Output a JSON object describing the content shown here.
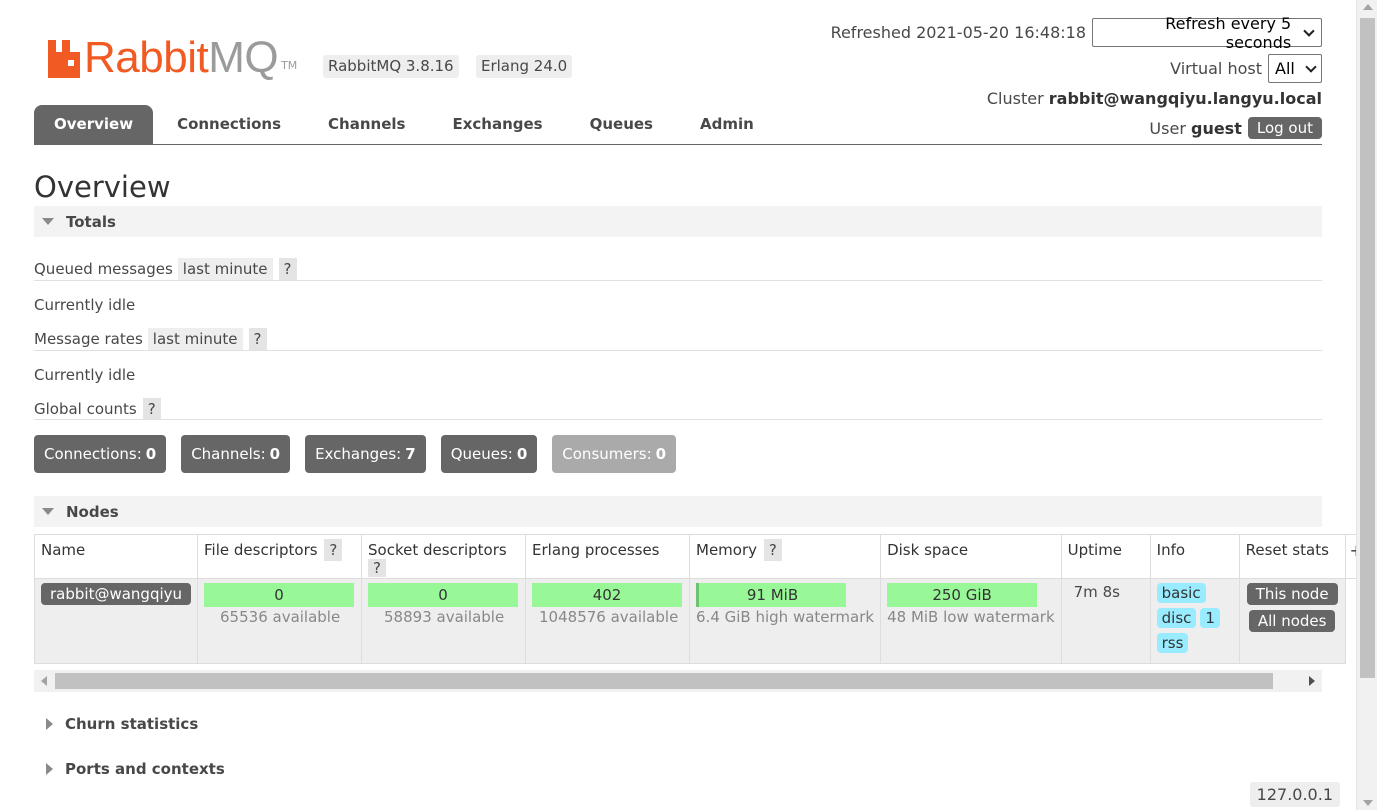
{
  "brand": {
    "logo_rabbit": "Rabbit",
    "logo_mq": "MQ",
    "logo_tm": "TM"
  },
  "versions": {
    "rabbitmq": "RabbitMQ 3.8.16",
    "erlang": "Erlang 24.0"
  },
  "header": {
    "refreshed_label": "Refreshed 2021-05-20 16:48:18",
    "refresh_select": "Refresh every 5 seconds",
    "vhost_label": "Virtual host",
    "vhost_select": "All",
    "cluster_label": "Cluster",
    "cluster_name": "rabbit@wangqiyu.langyu.local",
    "user_label": "User",
    "user_name": "guest",
    "logout": "Log out"
  },
  "tabs": [
    {
      "label": "Overview",
      "active": true
    },
    {
      "label": "Connections"
    },
    {
      "label": "Channels"
    },
    {
      "label": "Exchanges"
    },
    {
      "label": "Queues"
    },
    {
      "label": "Admin"
    }
  ],
  "page_title": "Overview",
  "totals": {
    "heading": "Totals",
    "queued_label": "Queued messages",
    "queued_range": "last minute",
    "help": "?",
    "queued_idle": "Currently idle",
    "rates_label": "Message rates",
    "rates_range": "last minute",
    "rates_idle": "Currently idle",
    "global_label": "Global counts"
  },
  "counts": [
    {
      "label": "Connections:",
      "value": "0"
    },
    {
      "label": "Channels:",
      "value": "0"
    },
    {
      "label": "Exchanges:",
      "value": "7"
    },
    {
      "label": "Queues:",
      "value": "0"
    },
    {
      "label": "Consumers:",
      "value": "0"
    }
  ],
  "nodes": {
    "heading": "Nodes",
    "columns": [
      "Name",
      "File descriptors",
      "Socket descriptors",
      "Erlang processes",
      "Memory",
      "Disk space",
      "Uptime",
      "Info",
      "Reset stats",
      "+"
    ],
    "row": {
      "name": "rabbit@wangqiyu",
      "fd_value": "0",
      "fd_sub": "65536 available",
      "sock_value": "0",
      "sock_sub": "58893 available",
      "proc_value": "402",
      "proc_sub": "1048576 available",
      "mem_value": "91 MiB",
      "mem_sub": "6.4 GiB high watermark",
      "disk_value": "250 GiB",
      "disk_sub": "48 MiB low watermark",
      "uptime": "7m 8s",
      "info_tags": [
        "basic",
        "disc",
        "1",
        "rss"
      ],
      "reset_this": "This node",
      "reset_all": "All nodes"
    }
  },
  "collapsed_sections": [
    "Churn statistics",
    "Ports and contexts"
  ],
  "footer_ip": "127.0.0.1",
  "colors": {
    "brand_orange": "#f15a22",
    "bar_green": "#98f898",
    "info_blue": "#99ebff",
    "dark_button": "#666666"
  }
}
